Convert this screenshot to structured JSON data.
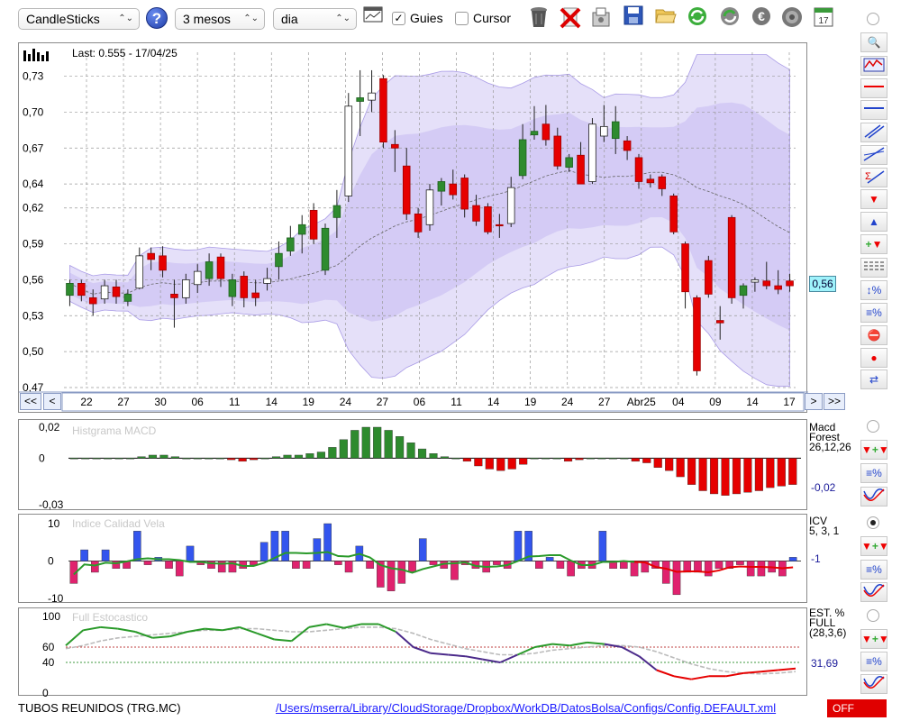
{
  "toolbar": {
    "chart_type": "CandleSticks",
    "period": "3 mesos",
    "interval": "dia",
    "guides_label": "Guies",
    "guides_checked": "✓",
    "cursor_label": "Cursor",
    "help": "?"
  },
  "main": {
    "last_label": "Last: 0.555 - 17/04/25",
    "current_price_tag": "0,56",
    "nav": {
      "first": "<<",
      "prev": "<",
      "next": ">",
      "last": ">>"
    }
  },
  "macd": {
    "title": "Histgrama MACD",
    "name1": "Macd",
    "name2": "Forest",
    "params": "26,12,26",
    "value": "-0,02"
  },
  "icv": {
    "title": "Indice Calidad Vela",
    "name": "ICV",
    "params": "5, 3, 1",
    "value": "-1"
  },
  "stoch": {
    "title": "Full Estocastico",
    "name1": "EST. %",
    "name2": "FULL",
    "params": "(28,3,6)",
    "value": "31,69"
  },
  "status": {
    "ticker": "TUBOS REUNIDOS (TRG.MC)",
    "path": "/Users/mserra/Library/CloudStorage/Dropbox/WorkDB/DatosBolsa/Configs/Config.DEFAULT.xml",
    "realtime": "OFF"
  },
  "colors": {
    "up": "#2e8b2e",
    "down": "#e60000",
    "band": "#cfc6f4",
    "macd_pos": "#2e8b2e",
    "macd_neg": "#e60000",
    "icv_pos": "#3355ee",
    "icv_neg": "#e0226e",
    "stoch_green": "#2a9a2a",
    "stoch_purple": "#4b2a8a",
    "stoch_red": "#e60000"
  },
  "chart_data": [
    {
      "type": "candlestick",
      "ylim": [
        0.47,
        0.75
      ],
      "y_ticks": [
        "0,73",
        "0,70",
        "0,67",
        "0,64",
        "0,62",
        "0,59",
        "0,56",
        "0,53",
        "0,50",
        "0,47"
      ],
      "x_tick_labels": [
        "22",
        "27",
        "30",
        "06",
        "11",
        "14",
        "19",
        "24",
        "27",
        "06",
        "11",
        "14",
        "19",
        "24",
        "27",
        "Abr25",
        "04",
        "09",
        "14",
        "17"
      ],
      "candles": [
        {
          "o": 0.547,
          "h": 0.56,
          "l": 0.538,
          "c": 0.557
        },
        {
          "o": 0.557,
          "h": 0.56,
          "l": 0.542,
          "c": 0.547
        },
        {
          "o": 0.545,
          "h": 0.552,
          "l": 0.53,
          "c": 0.54
        },
        {
          "o": 0.544,
          "h": 0.56,
          "l": 0.54,
          "c": 0.555
        },
        {
          "o": 0.554,
          "h": 0.56,
          "l": 0.54,
          "c": 0.546
        },
        {
          "o": 0.542,
          "h": 0.552,
          "l": 0.538,
          "c": 0.548
        },
        {
          "o": 0.553,
          "h": 0.587,
          "l": 0.552,
          "c": 0.58
        },
        {
          "o": 0.582,
          "h": 0.587,
          "l": 0.568,
          "c": 0.577
        },
        {
          "o": 0.58,
          "h": 0.588,
          "l": 0.562,
          "c": 0.568
        },
        {
          "o": 0.548,
          "h": 0.56,
          "l": 0.52,
          "c": 0.545
        },
        {
          "o": 0.545,
          "h": 0.565,
          "l": 0.54,
          "c": 0.56
        },
        {
          "o": 0.556,
          "h": 0.573,
          "l": 0.549,
          "c": 0.567
        },
        {
          "o": 0.561,
          "h": 0.582,
          "l": 0.555,
          "c": 0.575
        },
        {
          "o": 0.579,
          "h": 0.582,
          "l": 0.554,
          "c": 0.561
        },
        {
          "o": 0.546,
          "h": 0.565,
          "l": 0.538,
          "c": 0.56
        },
        {
          "o": 0.563,
          "h": 0.567,
          "l": 0.537,
          "c": 0.545
        },
        {
          "o": 0.549,
          "h": 0.56,
          "l": 0.538,
          "c": 0.545
        },
        {
          "o": 0.557,
          "h": 0.57,
          "l": 0.551,
          "c": 0.561
        },
        {
          "o": 0.571,
          "h": 0.592,
          "l": 0.56,
          "c": 0.582
        },
        {
          "o": 0.584,
          "h": 0.605,
          "l": 0.58,
          "c": 0.595
        },
        {
          "o": 0.598,
          "h": 0.614,
          "l": 0.582,
          "c": 0.606
        },
        {
          "o": 0.618,
          "h": 0.624,
          "l": 0.59,
          "c": 0.594
        },
        {
          "o": 0.568,
          "h": 0.607,
          "l": 0.564,
          "c": 0.603
        },
        {
          "o": 0.612,
          "h": 0.635,
          "l": 0.595,
          "c": 0.622
        },
        {
          "o": 0.63,
          "h": 0.716,
          "l": 0.625,
          "c": 0.705
        },
        {
          "o": 0.709,
          "h": 0.735,
          "l": 0.68,
          "c": 0.712
        },
        {
          "o": 0.71,
          "h": 0.735,
          "l": 0.7,
          "c": 0.716
        },
        {
          "o": 0.728,
          "h": 0.731,
          "l": 0.67,
          "c": 0.675
        },
        {
          "o": 0.673,
          "h": 0.685,
          "l": 0.65,
          "c": 0.67
        },
        {
          "o": 0.655,
          "h": 0.67,
          "l": 0.61,
          "c": 0.615
        },
        {
          "o": 0.615,
          "h": 0.62,
          "l": 0.595,
          "c": 0.6
        },
        {
          "o": 0.606,
          "h": 0.64,
          "l": 0.601,
          "c": 0.635
        },
        {
          "o": 0.634,
          "h": 0.645,
          "l": 0.622,
          "c": 0.642
        },
        {
          "o": 0.64,
          "h": 0.652,
          "l": 0.627,
          "c": 0.631
        },
        {
          "o": 0.645,
          "h": 0.648,
          "l": 0.612,
          "c": 0.619
        },
        {
          "o": 0.622,
          "h": 0.631,
          "l": 0.605,
          "c": 0.609
        },
        {
          "o": 0.621,
          "h": 0.624,
          "l": 0.598,
          "c": 0.6
        },
        {
          "o": 0.606,
          "h": 0.615,
          "l": 0.595,
          "c": 0.605
        },
        {
          "o": 0.607,
          "h": 0.646,
          "l": 0.604,
          "c": 0.637
        },
        {
          "o": 0.647,
          "h": 0.69,
          "l": 0.644,
          "c": 0.677
        },
        {
          "o": 0.681,
          "h": 0.705,
          "l": 0.677,
          "c": 0.684
        },
        {
          "o": 0.69,
          "h": 0.706,
          "l": 0.672,
          "c": 0.677
        },
        {
          "o": 0.68,
          "h": 0.687,
          "l": 0.652,
          "c": 0.655
        },
        {
          "o": 0.654,
          "h": 0.665,
          "l": 0.65,
          "c": 0.662
        },
        {
          "o": 0.664,
          "h": 0.675,
          "l": 0.64,
          "c": 0.64
        },
        {
          "o": 0.642,
          "h": 0.695,
          "l": 0.64,
          "c": 0.69
        },
        {
          "o": 0.68,
          "h": 0.706,
          "l": 0.675,
          "c": 0.688
        },
        {
          "o": 0.678,
          "h": 0.705,
          "l": 0.665,
          "c": 0.692
        },
        {
          "o": 0.676,
          "h": 0.68,
          "l": 0.66,
          "c": 0.668
        },
        {
          "o": 0.662,
          "h": 0.665,
          "l": 0.636,
          "c": 0.642
        },
        {
          "o": 0.644,
          "h": 0.648,
          "l": 0.637,
          "c": 0.641
        },
        {
          "o": 0.646,
          "h": 0.648,
          "l": 0.63,
          "c": 0.636
        },
        {
          "o": 0.63,
          "h": 0.632,
          "l": 0.598,
          "c": 0.6
        },
        {
          "o": 0.59,
          "h": 0.592,
          "l": 0.536,
          "c": 0.55
        },
        {
          "o": 0.545,
          "h": 0.547,
          "l": 0.48,
          "c": 0.484
        },
        {
          "o": 0.576,
          "h": 0.58,
          "l": 0.545,
          "c": 0.548
        },
        {
          "o": 0.526,
          "h": 0.538,
          "l": 0.51,
          "c": 0.524
        },
        {
          "o": 0.612,
          "h": 0.614,
          "l": 0.54,
          "c": 0.545
        },
        {
          "o": 0.547,
          "h": 0.557,
          "l": 0.536,
          "c": 0.555
        },
        {
          "o": 0.558,
          "h": 0.562,
          "l": 0.55,
          "c": 0.56
        },
        {
          "o": 0.559,
          "h": 0.575,
          "l": 0.552,
          "c": 0.555
        },
        {
          "o": 0.555,
          "h": 0.568,
          "l": 0.548,
          "c": 0.552
        },
        {
          "o": 0.559,
          "h": 0.565,
          "l": 0.55,
          "c": 0.555
        }
      ]
    },
    {
      "type": "bar",
      "title": "Histgrama MACD",
      "ylim": [
        -0.03,
        0.02
      ],
      "y_ticks": [
        "0,02",
        "0",
        "-0,03"
      ],
      "values": [
        0,
        0,
        0,
        0,
        0,
        0,
        0.001,
        0.002,
        0.002,
        0.001,
        0,
        0,
        0,
        0,
        -0.001,
        -0.002,
        -0.001,
        0,
        0.001,
        0.002,
        0.002,
        0.003,
        0.004,
        0.007,
        0.012,
        0.018,
        0.02,
        0.02,
        0.018,
        0.014,
        0.01,
        0.006,
        0.003,
        0.001,
        0,
        -0.002,
        -0.005,
        -0.007,
        -0.008,
        -0.007,
        -0.004,
        0,
        0,
        0,
        -0.002,
        -0.001,
        0,
        0,
        0,
        0,
        -0.002,
        -0.003,
        -0.006,
        -0.008,
        -0.012,
        -0.017,
        -0.021,
        -0.023,
        -0.024,
        -0.023,
        -0.022,
        -0.021,
        -0.019,
        -0.018,
        -0.017
      ]
    },
    {
      "type": "bar",
      "title": "Indice Calidad Vela",
      "ylim": [
        -10,
        10
      ],
      "y_ticks": [
        "10",
        "0",
        "-10"
      ],
      "values": [
        -6,
        3,
        -3,
        3,
        -2,
        -2,
        8,
        -1,
        1,
        -2,
        -4,
        4,
        -1,
        -2,
        -3,
        -3,
        -2,
        -1,
        5,
        8,
        8,
        -2,
        -2,
        6,
        10,
        -1,
        -3,
        4,
        -2,
        -7,
        -8,
        -6,
        -3,
        6,
        -1,
        -2,
        -5,
        -1,
        -2,
        -3,
        -1,
        -2,
        8,
        8,
        -2,
        1,
        -2,
        -4,
        -2,
        -2,
        8,
        -2,
        -2,
        -4,
        -3,
        -2,
        -6,
        -9,
        -3,
        -3,
        -4,
        -2,
        -2,
        -1,
        -4,
        -4,
        -3,
        -4,
        1
      ]
    },
    {
      "type": "line",
      "title": "Full Estocastico",
      "ylim": [
        0,
        100
      ],
      "y_ticks": [
        "100",
        "60",
        "40",
        "0"
      ],
      "series": [
        {
          "values": [
            62,
            82,
            86,
            84,
            80,
            72,
            74,
            80,
            84,
            82,
            86,
            78,
            70,
            68,
            86,
            90,
            85,
            90,
            90,
            80,
            60,
            52,
            50,
            48,
            44,
            40,
            50,
            60,
            64,
            62,
            66,
            64,
            60,
            48,
            30,
            22,
            18,
            22,
            22,
            26,
            28,
            30,
            32
          ]
        },
        {
          "values": [
            58,
            62,
            68,
            72,
            74,
            76,
            78,
            80,
            82,
            82,
            84,
            84,
            82,
            80,
            80,
            82,
            84,
            86,
            86,
            84,
            78,
            70,
            64,
            58,
            54,
            50,
            50,
            52,
            56,
            58,
            60,
            62,
            62,
            60,
            54,
            46,
            38,
            32,
            28,
            26,
            25,
            26,
            28
          ]
        }
      ]
    }
  ]
}
